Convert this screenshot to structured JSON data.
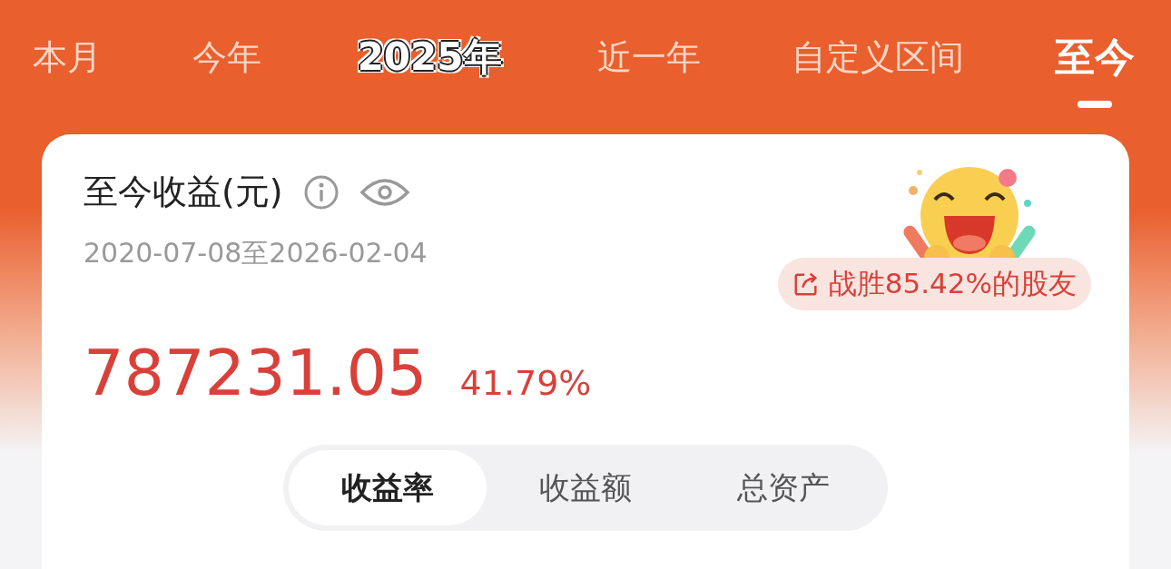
{
  "tabs": [
    {
      "label": "本月",
      "kind": "plain",
      "selected": false
    },
    {
      "label": "今年",
      "kind": "plain",
      "selected": false
    },
    {
      "label": "2025年",
      "kind": "sticker",
      "selected": false
    },
    {
      "label": "近一年",
      "kind": "plain",
      "selected": false
    },
    {
      "label": "自定义区间",
      "kind": "plain",
      "selected": false
    },
    {
      "label": "至今",
      "kind": "plain",
      "selected": true
    }
  ],
  "card": {
    "title": "至今收益(元)",
    "date_range": "2020-07-08至2026-02-04",
    "amount": "787231.05",
    "rate": "41.79%",
    "rank_badge": "战胜85.42%的股友"
  },
  "segments": [
    {
      "label": "收益率",
      "selected": true
    },
    {
      "label": "收益额",
      "selected": false
    },
    {
      "label": "总资产",
      "selected": false
    }
  ]
}
